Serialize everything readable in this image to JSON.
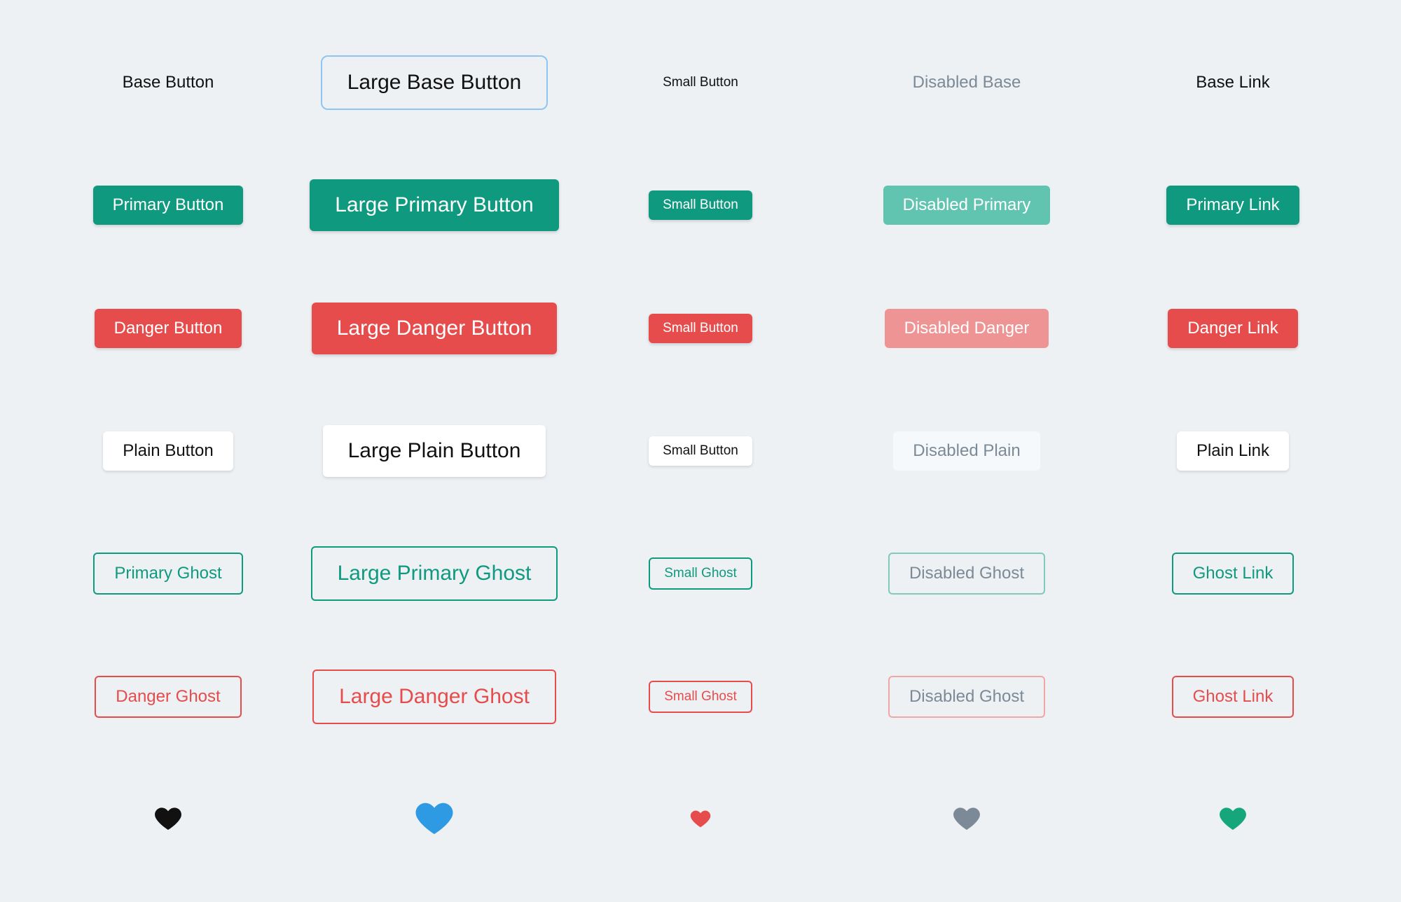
{
  "colors": {
    "primary": "#0f997e",
    "danger": "#e64c4c",
    "text": "#111111",
    "disabled_text": "#7c8a97",
    "focus_ring": "#8ec5f5",
    "plain_bg": "#ffffff"
  },
  "rows": [
    {
      "variant": "base",
      "cells": [
        {
          "label": "Base Button",
          "size": "normal",
          "state": "normal"
        },
        {
          "label": "Large Base Button",
          "size": "large",
          "state": "focused"
        },
        {
          "label": "Small Button",
          "size": "small",
          "state": "normal"
        },
        {
          "label": "Disabled Base",
          "size": "normal",
          "state": "disabled"
        },
        {
          "label": "Base Link",
          "size": "normal",
          "state": "normal",
          "link": true
        }
      ]
    },
    {
      "variant": "primary",
      "cells": [
        {
          "label": "Primary Button",
          "size": "normal",
          "state": "normal"
        },
        {
          "label": "Large Primary Button",
          "size": "large",
          "state": "normal"
        },
        {
          "label": "Small Button",
          "size": "small",
          "state": "normal"
        },
        {
          "label": "Disabled Primary",
          "size": "normal",
          "state": "disabled"
        },
        {
          "label": "Primary Link",
          "size": "normal",
          "state": "normal",
          "link": true
        }
      ]
    },
    {
      "variant": "danger",
      "cells": [
        {
          "label": "Danger Button",
          "size": "normal",
          "state": "normal"
        },
        {
          "label": "Large Danger Button",
          "size": "large",
          "state": "normal"
        },
        {
          "label": "Small Button",
          "size": "small",
          "state": "normal"
        },
        {
          "label": "Disabled Danger",
          "size": "normal",
          "state": "disabled"
        },
        {
          "label": "Danger Link",
          "size": "normal",
          "state": "normal",
          "link": true
        }
      ]
    },
    {
      "variant": "plain",
      "cells": [
        {
          "label": "Plain Button",
          "size": "normal",
          "state": "normal"
        },
        {
          "label": "Large Plain Button",
          "size": "large",
          "state": "normal"
        },
        {
          "label": "Small Button",
          "size": "small",
          "state": "normal"
        },
        {
          "label": "Disabled Plain",
          "size": "normal",
          "state": "disabled"
        },
        {
          "label": "Plain Link",
          "size": "normal",
          "state": "normal",
          "link": true
        }
      ]
    },
    {
      "variant": "primary-ghost",
      "cells": [
        {
          "label": "Primary Ghost",
          "size": "normal",
          "state": "normal"
        },
        {
          "label": "Large Primary Ghost",
          "size": "large",
          "state": "normal"
        },
        {
          "label": "Small Ghost",
          "size": "small",
          "state": "normal"
        },
        {
          "label": "Disabled Ghost",
          "size": "normal",
          "state": "disabled"
        },
        {
          "label": "Ghost Link",
          "size": "normal",
          "state": "normal",
          "link": true
        }
      ]
    },
    {
      "variant": "danger-ghost",
      "cells": [
        {
          "label": "Danger Ghost",
          "size": "normal",
          "state": "normal"
        },
        {
          "label": "Large Danger Ghost",
          "size": "large",
          "state": "normal"
        },
        {
          "label": "Small Ghost",
          "size": "small",
          "state": "normal"
        },
        {
          "label": "Disabled Ghost",
          "size": "normal",
          "state": "disabled"
        },
        {
          "label": "Ghost Link",
          "size": "normal",
          "state": "normal",
          "link": true
        }
      ]
    }
  ],
  "icon_row": [
    {
      "icon": "heart",
      "color": "black",
      "size": 40,
      "state": "normal"
    },
    {
      "icon": "heart",
      "color": "blue",
      "size": 56,
      "state": "normal"
    },
    {
      "icon": "heart",
      "color": "red",
      "size": 30,
      "state": "normal"
    },
    {
      "icon": "heart",
      "color": "gray",
      "size": 40,
      "state": "disabled"
    },
    {
      "icon": "heart",
      "color": "green",
      "size": 40,
      "state": "normal"
    }
  ]
}
